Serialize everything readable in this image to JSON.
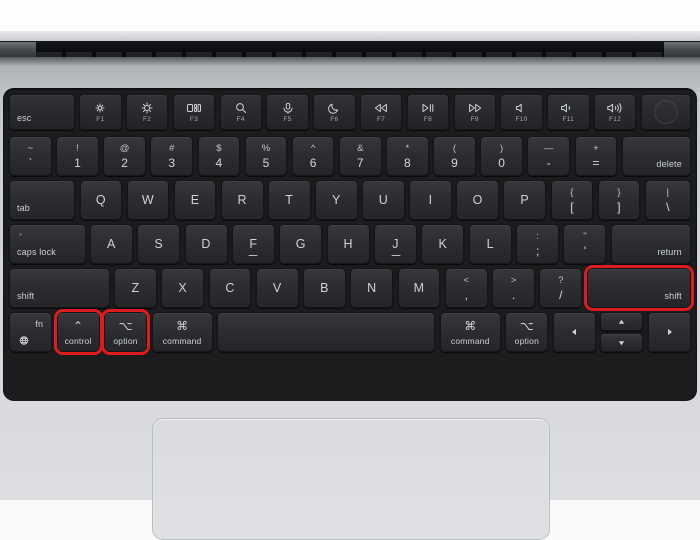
{
  "device": {
    "name": "macbook-laptop",
    "chassis_color": "#cdd0d3",
    "keyboard_well_color": "#1b1c1e",
    "key_color": "#2c2e31",
    "key_text_color": "#d2d4d6",
    "highlight_color": "#e01b1b"
  },
  "highlighted_keys": [
    "control",
    "option",
    "shift-right"
  ],
  "keyboard": {
    "rows": [
      {
        "name": "function-row",
        "keys": [
          {
            "name": "esc",
            "label": "esc",
            "type": "word-bl"
          },
          {
            "name": "f1",
            "icon": "brightness-down-icon",
            "sub": "F1",
            "type": "icon-fn"
          },
          {
            "name": "f2",
            "icon": "brightness-up-icon",
            "sub": "F2",
            "type": "icon-fn"
          },
          {
            "name": "f3",
            "icon": "mission-control-icon",
            "sub": "F3",
            "type": "icon-fn"
          },
          {
            "name": "f4",
            "icon": "spotlight-search-icon",
            "sub": "F4",
            "type": "icon-fn"
          },
          {
            "name": "f5",
            "icon": "dictation-mic-icon",
            "sub": "F5",
            "type": "icon-fn"
          },
          {
            "name": "f6",
            "icon": "do-not-disturb-moon-icon",
            "sub": "F6",
            "type": "icon-fn"
          },
          {
            "name": "f7",
            "icon": "rewind-icon",
            "sub": "F7",
            "type": "icon-fn"
          },
          {
            "name": "f8",
            "icon": "play-pause-icon",
            "sub": "F8",
            "type": "icon-fn"
          },
          {
            "name": "f9",
            "icon": "fast-forward-icon",
            "sub": "F9",
            "type": "icon-fn"
          },
          {
            "name": "f10",
            "icon": "mute-icon",
            "sub": "F10",
            "type": "icon-fn"
          },
          {
            "name": "f11",
            "icon": "volume-down-icon",
            "sub": "F11",
            "type": "icon-fn"
          },
          {
            "name": "f12",
            "icon": "volume-up-icon",
            "sub": "F12",
            "type": "icon-fn"
          },
          {
            "name": "touch-id",
            "icon": "touch-id-icon",
            "type": "touchid"
          }
        ]
      },
      {
        "name": "number-row",
        "keys": [
          {
            "name": "backtick",
            "top": "~",
            "bottom": "`",
            "type": "dual"
          },
          {
            "name": "digit-1",
            "top": "!",
            "bottom": "1",
            "type": "dual"
          },
          {
            "name": "digit-2",
            "top": "@",
            "bottom": "2",
            "type": "dual"
          },
          {
            "name": "digit-3",
            "top": "#",
            "bottom": "3",
            "type": "dual"
          },
          {
            "name": "digit-4",
            "top": "$",
            "bottom": "4",
            "type": "dual"
          },
          {
            "name": "digit-5",
            "top": "%",
            "bottom": "5",
            "type": "dual"
          },
          {
            "name": "digit-6",
            "top": "^",
            "bottom": "6",
            "type": "dual"
          },
          {
            "name": "digit-7",
            "top": "&",
            "bottom": "7",
            "type": "dual"
          },
          {
            "name": "digit-8",
            "top": "*",
            "bottom": "8",
            "type": "dual"
          },
          {
            "name": "digit-9",
            "top": "(",
            "bottom": "9",
            "type": "dual"
          },
          {
            "name": "digit-0",
            "top": ")",
            "bottom": "0",
            "type": "dual"
          },
          {
            "name": "minus",
            "top": "—",
            "bottom": "-",
            "type": "dual"
          },
          {
            "name": "equal",
            "top": "+",
            "bottom": "=",
            "type": "dual"
          },
          {
            "name": "delete",
            "label": "delete",
            "type": "word-br"
          }
        ]
      },
      {
        "name": "qwerty-row",
        "keys": [
          {
            "name": "tab",
            "label": "tab",
            "type": "word-bl"
          },
          {
            "name": "key-q",
            "label": "Q",
            "type": "alpha"
          },
          {
            "name": "key-w",
            "label": "W",
            "type": "alpha"
          },
          {
            "name": "key-e",
            "label": "E",
            "type": "alpha"
          },
          {
            "name": "key-r",
            "label": "R",
            "type": "alpha"
          },
          {
            "name": "key-t",
            "label": "T",
            "type": "alpha"
          },
          {
            "name": "key-y",
            "label": "Y",
            "type": "alpha"
          },
          {
            "name": "key-u",
            "label": "U",
            "type": "alpha"
          },
          {
            "name": "key-i",
            "label": "I",
            "type": "alpha"
          },
          {
            "name": "key-o",
            "label": "O",
            "type": "alpha"
          },
          {
            "name": "key-p",
            "label": "P",
            "type": "alpha"
          },
          {
            "name": "bracket-left",
            "top": "{",
            "bottom": "[",
            "type": "dual"
          },
          {
            "name": "bracket-right",
            "top": "}",
            "bottom": "]",
            "type": "dual"
          },
          {
            "name": "backslash",
            "top": "|",
            "bottom": "\\",
            "type": "dual"
          }
        ]
      },
      {
        "name": "home-row",
        "keys": [
          {
            "name": "caps-lock",
            "label": "caps lock",
            "type": "capslock"
          },
          {
            "name": "key-a",
            "label": "A",
            "type": "alpha"
          },
          {
            "name": "key-s",
            "label": "S",
            "type": "alpha"
          },
          {
            "name": "key-d",
            "label": "D",
            "type": "alpha"
          },
          {
            "name": "key-f",
            "label": "F",
            "type": "alpha-homing"
          },
          {
            "name": "key-g",
            "label": "G",
            "type": "alpha"
          },
          {
            "name": "key-h",
            "label": "H",
            "type": "alpha"
          },
          {
            "name": "key-j",
            "label": "J",
            "type": "alpha-homing"
          },
          {
            "name": "key-k",
            "label": "K",
            "type": "alpha"
          },
          {
            "name": "key-l",
            "label": "L",
            "type": "alpha"
          },
          {
            "name": "semicolon",
            "top": ":",
            "bottom": ";",
            "type": "dual"
          },
          {
            "name": "quote",
            "top": "\"",
            "bottom": "'",
            "type": "dual"
          },
          {
            "name": "return",
            "label": "return",
            "type": "word-br"
          }
        ]
      },
      {
        "name": "shift-row",
        "keys": [
          {
            "name": "shift-left",
            "label": "shift",
            "type": "word-bl"
          },
          {
            "name": "key-z",
            "label": "Z",
            "type": "alpha"
          },
          {
            "name": "key-x",
            "label": "X",
            "type": "alpha"
          },
          {
            "name": "key-c",
            "label": "C",
            "type": "alpha"
          },
          {
            "name": "key-v",
            "label": "V",
            "type": "alpha"
          },
          {
            "name": "key-b",
            "label": "B",
            "type": "alpha"
          },
          {
            "name": "key-n",
            "label": "N",
            "type": "alpha"
          },
          {
            "name": "key-m",
            "label": "M",
            "type": "alpha"
          },
          {
            "name": "comma",
            "top": "<",
            "bottom": ",",
            "type": "dual"
          },
          {
            "name": "period",
            "top": ">",
            "bottom": ".",
            "type": "dual"
          },
          {
            "name": "slash",
            "top": "?",
            "bottom": "/",
            "type": "dual"
          },
          {
            "name": "shift-right",
            "label": "shift",
            "type": "word-br",
            "highlighted": true
          }
        ]
      },
      {
        "name": "bottom-row",
        "keys": [
          {
            "name": "fn",
            "label": "fn",
            "icon": "globe-icon",
            "type": "fn"
          },
          {
            "name": "control",
            "label": "control",
            "glyph": "⌃",
            "type": "mod",
            "highlighted": true
          },
          {
            "name": "option-left",
            "label": "option",
            "glyph": "⌥",
            "type": "mod",
            "highlighted": true
          },
          {
            "name": "command-left",
            "label": "command",
            "glyph": "⌘",
            "type": "mod"
          },
          {
            "name": "space",
            "label": "",
            "type": "space"
          },
          {
            "name": "command-right",
            "label": "command",
            "glyph": "⌘",
            "type": "mod"
          },
          {
            "name": "option-right",
            "label": "option",
            "glyph": "⌥",
            "type": "mod"
          },
          {
            "name": "arrow-left",
            "icon": "arrow-left-icon",
            "type": "arrow"
          },
          {
            "name": "arrow-up",
            "icon": "arrow-up-icon",
            "type": "arrow-half"
          },
          {
            "name": "arrow-down",
            "icon": "arrow-down-icon",
            "type": "arrow-half"
          },
          {
            "name": "arrow-right",
            "icon": "arrow-right-icon",
            "type": "arrow"
          }
        ]
      }
    ]
  },
  "trackpad": {
    "name": "trackpad",
    "label": ""
  }
}
